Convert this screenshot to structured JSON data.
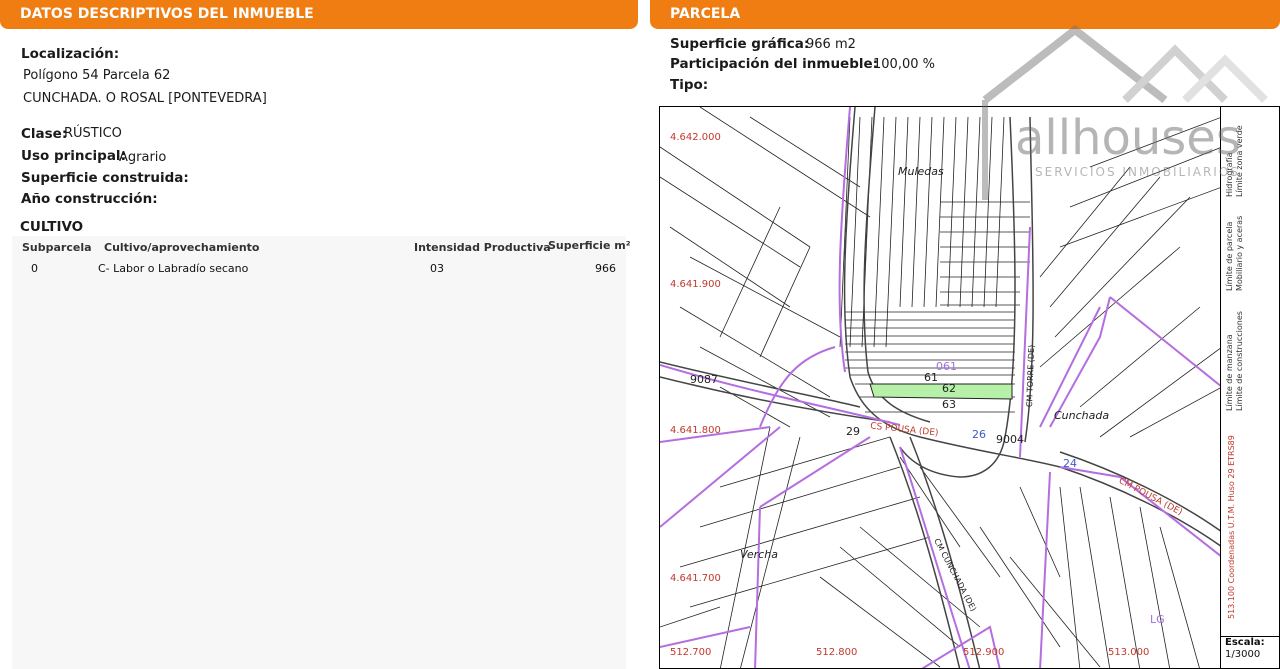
{
  "left_panel": {
    "title": "DATOS DESCRIPTIVOS DEL INMUEBLE",
    "localizacion_label": "Localización:",
    "localizacion_line1": "Polígono 54 Parcela 62",
    "localizacion_line2": "CUNCHADA. O ROSAL [PONTEVEDRA]",
    "clase_label": "Clase:",
    "clase_value": "RÚSTICO",
    "uso_label": "Uso principal:",
    "uso_value": "Agrario",
    "superficie_label": "Superficie construida:",
    "anio_label": "Año construcción:",
    "cultivo_title": "CULTIVO",
    "cultivo_headers": [
      "Subparcela",
      "Cultivo/aprovechamiento",
      "Intensidad Productiva",
      "Superficie m²"
    ],
    "cultivo_rows": [
      [
        "0",
        "C- Labor o Labradío secano",
        "03",
        "966"
      ]
    ]
  },
  "right_panel": {
    "title": "PARCELA",
    "sup_grafica_label": "Superficie gráfica:",
    "sup_grafica_value": "966 m2",
    "participacion_label": "Participación del inmueble:",
    "participacion_value": "100,00 %",
    "tipo_label": "Tipo:"
  },
  "map": {
    "coords_y": [
      "4.642.000",
      "4.641.900",
      "4.641.800",
      "4.641.700"
    ],
    "coords_x": [
      "512.700",
      "512.800",
      "512.900",
      "513.000"
    ],
    "place_names": [
      "Muledas",
      "Cunchada",
      "Vercha"
    ],
    "parcel_numbers": [
      "61",
      "62",
      "63",
      "9004",
      "9087",
      "29",
      "26",
      "24"
    ],
    "road_labels": [
      "CM TORRE (DE)",
      "CS POUSA (DE)",
      "CM POUSA (DE)",
      "CM CUNCHADA (DE)"
    ],
    "poly_labels": [
      "061",
      "LG"
    ],
    "highlight_color": "#b7f0a8",
    "boundary_color": "#b46ee0"
  },
  "legend": {
    "items": [
      "Hidrografía",
      "Límite zona verde",
      "Límite de parcela",
      "Mobiliario y aceras",
      "Límite de manzana",
      "Límite de construcciones"
    ],
    "coord_system": "513.100 Coordenadas U.T.M. Huso 29 ETRS89",
    "escala_label": "Escala:",
    "escala_value": "1/3000"
  },
  "watermark": {
    "brand": "allhouses",
    "tagline": "SERVICIOS INMOBILIARIOS"
  }
}
